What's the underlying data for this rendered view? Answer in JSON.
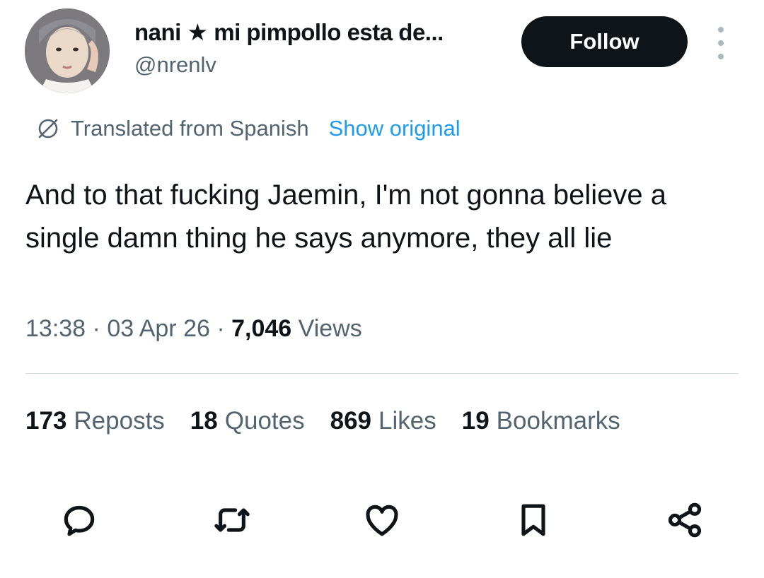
{
  "author": {
    "display_name": "nani ★ mi pimpollo esta de...",
    "handle": "@nrenlv"
  },
  "follow_label": "Follow",
  "translation": {
    "label": "Translated from Spanish",
    "show_original": "Show original"
  },
  "tweet": {
    "text": "And to that fucking Jaemin, I'm not gonna believe a single damn thing he says anymore, they all lie"
  },
  "meta": {
    "time": "13:38",
    "date": "03 Apr 26",
    "views_count": "7,046",
    "views_label": "Views"
  },
  "stats": [
    {
      "count": "173",
      "label": "Reposts"
    },
    {
      "count": "18",
      "label": "Quotes"
    },
    {
      "count": "869",
      "label": "Likes"
    },
    {
      "count": "19",
      "label": "Bookmarks"
    }
  ],
  "actions": [
    "reply-icon",
    "repost-icon",
    "like-icon",
    "bookmark-icon",
    "share-icon"
  ],
  "colors": {
    "text": "#0f1419",
    "secondary": "#536471",
    "link": "#1d9bf0",
    "button_bg": "#0f1419"
  }
}
